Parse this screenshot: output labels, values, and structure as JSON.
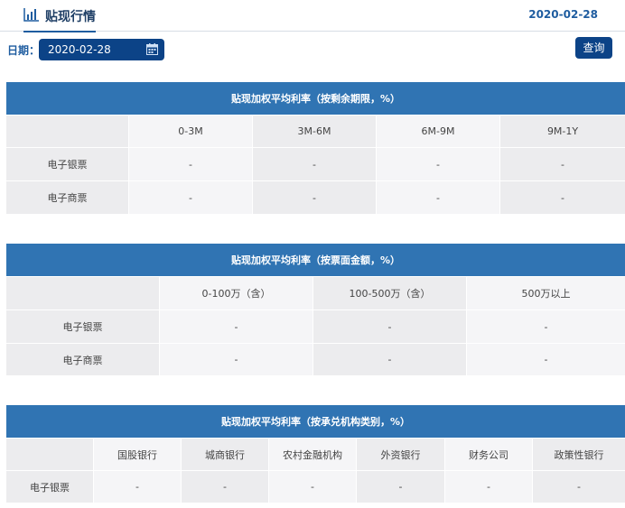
{
  "header": {
    "title": "贴现行情",
    "date": "2020-02-28"
  },
  "filter": {
    "date_label": "日期：",
    "date_value": "2020-02-28",
    "query_label": "查询"
  },
  "table1": {
    "caption": "贴现加权平均利率（按剩余期限，%）",
    "columns": [
      "0-3M",
      "3M-6M",
      "6M-9M",
      "9M-1Y"
    ],
    "rows": [
      {
        "label": "电子银票",
        "values": [
          "-",
          "-",
          "-",
          "-"
        ]
      },
      {
        "label": "电子商票",
        "values": [
          "-",
          "-",
          "-",
          "-"
        ]
      }
    ]
  },
  "table2": {
    "caption": "贴现加权平均利率（按票面金额，%）",
    "columns": [
      "0-100万（含）",
      "100-500万（含）",
      "500万以上"
    ],
    "rows": [
      {
        "label": "电子银票",
        "values": [
          "-",
          "-",
          "-"
        ]
      },
      {
        "label": "电子商票",
        "values": [
          "-",
          "-",
          "-"
        ]
      }
    ]
  },
  "table3": {
    "caption": "贴现加权平均利率（按承兑机构类别，%）",
    "columns": [
      "国股银行",
      "城商银行",
      "农村金融机构",
      "外资银行",
      "财务公司",
      "政策性银行"
    ],
    "rows": [
      {
        "label": "电子银票",
        "values": [
          "-",
          "-",
          "-",
          "-",
          "-",
          "-"
        ]
      }
    ]
  },
  "colors": {
    "accent": "#0c4387",
    "table_header": "#3074b3",
    "cell_gray": "#ececee"
  }
}
